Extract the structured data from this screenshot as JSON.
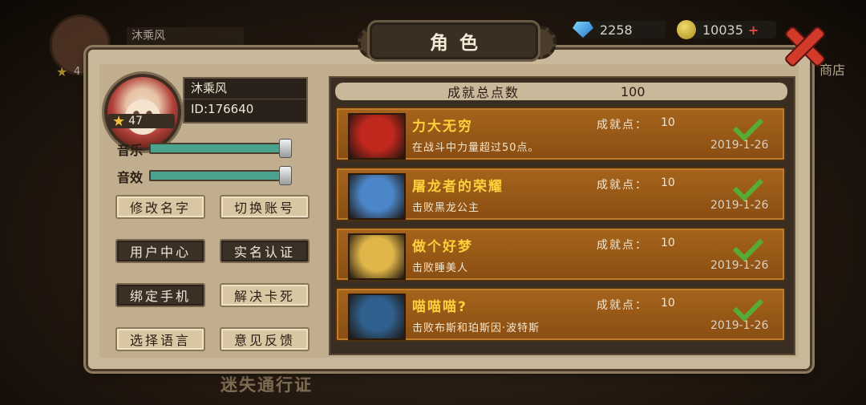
{
  "background": {
    "player_name": "沐乘风",
    "player_level": "4",
    "gems": "2258",
    "coins": "10035",
    "shop_label": "商店",
    "bottom_text": "迷失通行证"
  },
  "title": "角色",
  "profile": {
    "name": "沐乘风",
    "id": "ID:176640",
    "level": "47"
  },
  "settings": {
    "music_label": "音乐",
    "music_level": 1.0,
    "sfx_label": "音效",
    "sfx_level": 1.0
  },
  "buttons": {
    "rename": "修改名字",
    "switch_account": "切换账号",
    "user_center": "用户中心",
    "real_name": "实名认证",
    "bind_phone": "绑定手机",
    "fix_stuck": "解决卡死",
    "language": "选择语言",
    "feedback": "意见反馈"
  },
  "achievements": {
    "total_label": "成就总点数",
    "total_value": "100",
    "items": [
      {
        "title": "力大无穷",
        "desc": "在战斗中力量超过50点。",
        "pts_label": "成就点：",
        "pts": "10",
        "date": "2019-1-26",
        "icon": "red-devil-icon",
        "icon_color": "#c0281e"
      },
      {
        "title": "屠龙者的荣耀",
        "desc": "击败黑龙公主",
        "pts_label": "成就点：",
        "pts": "10",
        "date": "2019-1-26",
        "icon": "ice-king-icon",
        "icon_color": "#4a86c8"
      },
      {
        "title": "做个好梦",
        "desc": "击败睡美人",
        "pts_label": "成就点：",
        "pts": "10",
        "date": "2019-1-26",
        "icon": "sleeping-beauty-icon",
        "icon_color": "#e0b64a"
      },
      {
        "title": "喵喵喵?",
        "desc": "击败布斯和珀斯因·波特斯",
        "pts_label": "成就点：",
        "pts": "10",
        "date": "2019-1-26",
        "icon": "blue-troll-icon",
        "icon_color": "#2f5f8c"
      }
    ]
  }
}
